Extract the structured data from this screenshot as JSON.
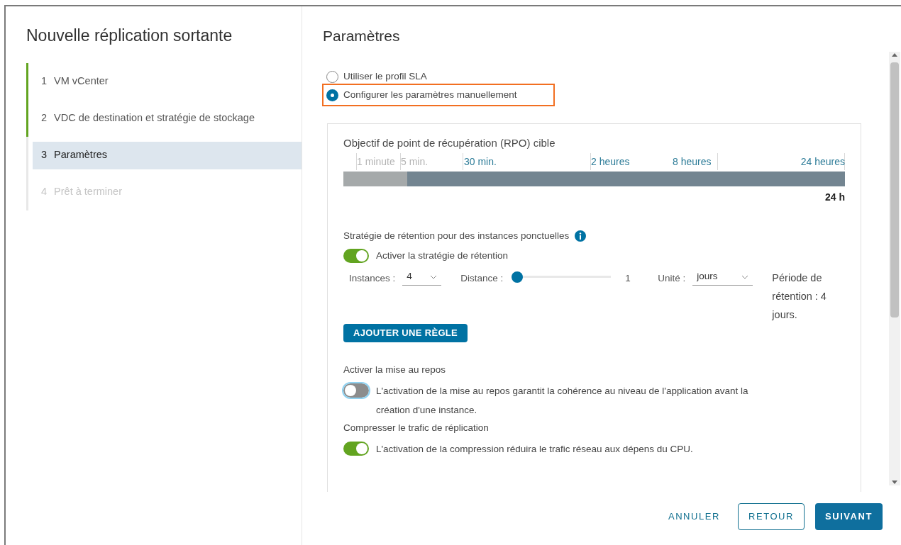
{
  "dialog_title": "Nouvelle réplication sortante",
  "steps": [
    {
      "number": "1",
      "label": "VM vCenter",
      "completed": true,
      "selected": false,
      "disabled": false
    },
    {
      "number": "2",
      "label": "VDC de destination et stratégie de stockage",
      "completed": true,
      "selected": false,
      "disabled": false
    },
    {
      "number": "3",
      "label": "Paramètres",
      "completed": false,
      "selected": true,
      "disabled": false
    },
    {
      "number": "4",
      "label": "Prêt à terminer",
      "completed": false,
      "selected": false,
      "disabled": true
    }
  ],
  "page_title": "Paramètres",
  "radios": [
    {
      "label": "Utiliser le profil SLA",
      "selected": false,
      "highlighted": false
    },
    {
      "label": "Configurer les paramètres manuellement",
      "selected": true,
      "highlighted": true
    }
  ],
  "rpo": {
    "label": "Objectif de point de récupération (RPO) cible",
    "ticks": [
      {
        "label": "1 minute",
        "disabled": true
      },
      {
        "label": "5 min.",
        "disabled": true
      },
      {
        "label": "30 min.",
        "disabled": false
      },
      {
        "label": "2 heures",
        "disabled": false
      },
      {
        "label": "8 heures",
        "disabled": false
      },
      {
        "label": "24 heures",
        "disabled": false
      }
    ],
    "level": 1,
    "reading": "24 h"
  },
  "retention": {
    "label": "Stratégie de rétention pour des instances ponctuelles",
    "toggle_on": true,
    "toggle_label": "Activer la stratégie de rétention",
    "instances_label": "Instances :",
    "instances_value": "4",
    "distance_label": "Distance :",
    "distance": {
      "level": 0
    },
    "distance_reading": "1",
    "unit_label": "Unité :",
    "unit_value": "jours",
    "period": "Période de rétention : 4 jours.",
    "add_button": "AJOUTER UNE RÈGLE"
  },
  "options": [
    {
      "title": "Activer la mise au repos",
      "on": false,
      "focused": true,
      "description": "L'activation de la mise au repos garantit la cohérence au niveau de l'application avant la création d'une instance."
    },
    {
      "title": "Compresser le trafic de réplication",
      "on": true,
      "focused": false,
      "description": "L'activation de la compression réduira le trafic réseau aux dépens du CPU."
    }
  ],
  "buttons": [
    {
      "label": "ANNULER",
      "kind": "link"
    },
    {
      "label": "RETOUR",
      "kind": "outline"
    },
    {
      "label": "SUIVANT",
      "kind": "primary"
    }
  ]
}
